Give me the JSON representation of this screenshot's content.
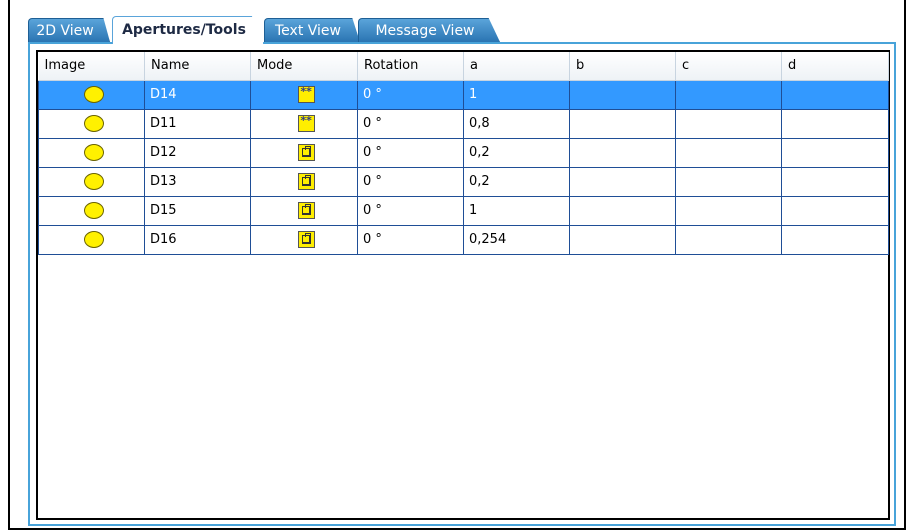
{
  "tabs": [
    {
      "label": "2D View",
      "active": false
    },
    {
      "label": "Apertures/Tools",
      "active": true
    },
    {
      "label": "Text View",
      "active": false
    },
    {
      "label": "Message View",
      "active": false
    }
  ],
  "table": {
    "columns": [
      "Image",
      "Name",
      "Mode",
      "Rotation",
      "a",
      "b",
      "c",
      "d"
    ],
    "rows": [
      {
        "image": "yellow-circle-icon",
        "name": "D14",
        "mode": "stars-icon",
        "rotation": "0 °",
        "a": "1",
        "b": "",
        "c": "",
        "d": "",
        "selected": true
      },
      {
        "image": "yellow-circle-icon",
        "name": "D11",
        "mode": "stars-icon",
        "rotation": "0 °",
        "a": "0,8",
        "b": "",
        "c": "",
        "d": "",
        "selected": false
      },
      {
        "image": "yellow-circle-icon",
        "name": "D12",
        "mode": "box-icon",
        "rotation": "0 °",
        "a": "0,2",
        "b": "",
        "c": "",
        "d": "",
        "selected": false
      },
      {
        "image": "yellow-circle-icon",
        "name": "D13",
        "mode": "box-icon",
        "rotation": "0 °",
        "a": "0,2",
        "b": "",
        "c": "",
        "d": "",
        "selected": false
      },
      {
        "image": "yellow-circle-icon",
        "name": "D15",
        "mode": "box-icon",
        "rotation": "0 °",
        "a": "1",
        "b": "",
        "c": "",
        "d": "",
        "selected": false
      },
      {
        "image": "yellow-circle-icon",
        "name": "D16",
        "mode": "box-icon",
        "rotation": "0 °",
        "a": "0,254",
        "b": "",
        "c": "",
        "d": "",
        "selected": false
      }
    ]
  },
  "colors": {
    "selection": "#3399ff",
    "tab_blue": "#2a74b2",
    "panel_border": "#48a3d9",
    "grid_line": "#1f4e96",
    "aperture_yellow": "#fff100"
  }
}
